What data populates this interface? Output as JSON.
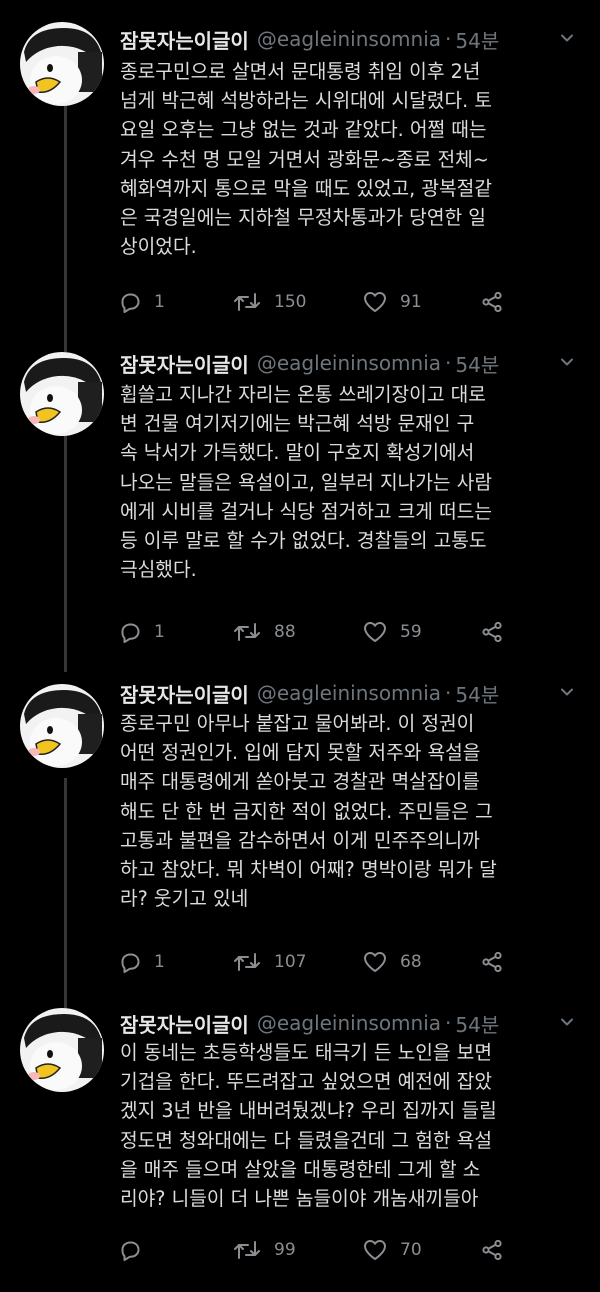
{
  "tweets": [
    {
      "display_name": "잠못자는이글이",
      "handle": "@eagleininsomnia",
      "separator": "·",
      "time": "54분",
      "lines": [
        "종로구민으로 살면서 문대통령 취임 이후 2년",
        "넘게 박근혜 석방하라는 시위대에 시달렸다. 토",
        "요일 오후는 그냥 없는 것과 같았다. 어쩔 때는",
        "겨우 수천 명 모일 거면서 광화문~종로 전체~",
        "혜화역까지 통으로 막을 때도 있었고, 광복절같",
        "은 국경일에는 지하철 무정차통과가 당연한 일",
        "상이었다."
      ],
      "replies": "1",
      "retweets": "150",
      "likes": "91"
    },
    {
      "display_name": "잠못자는이글이",
      "handle": "@eagleininsomnia",
      "separator": "·",
      "time": "54분",
      "lines": [
        "휩쓸고 지나간 자리는 온통 쓰레기장이고 대로",
        "변 건물 여기저기에는  박근혜 석방 문재인 구",
        "속 낙서가 가득했다. 말이 구호지 확성기에서",
        "나오는 말들은 욕설이고, 일부러 지나가는 사람",
        "에게 시비를 걸거나 식당 점거하고 크게 떠드는",
        "등 이루 말로 할 수가 없었다. 경찰들의 고통도",
        "극심했다."
      ],
      "replies": "1",
      "retweets": "88",
      "likes": "59"
    },
    {
      "display_name": "잠못자는이글이",
      "handle": "@eagleininsomnia",
      "separator": "·",
      "time": "54분",
      "lines": [
        "종로구민 아무나 붙잡고 물어봐라. 이 정권이",
        "어떤 정권인가. 입에 담지 못할 저주와 욕설을",
        "매주 대통령에게 쏟아붓고 경찰관 멱살잡이를",
        "해도 단 한 번 금지한 적이 없었다. 주민들은 그",
        "고통과 불편을 감수하면서 이게 민주주의니까",
        "하고 참았다. 뭐 차벽이 어째? 명박이랑 뭐가 달",
        "라? 웃기고 있네"
      ],
      "replies": "1",
      "retweets": "107",
      "likes": "68"
    },
    {
      "display_name": "잠못자는이글이",
      "handle": "@eagleininsomnia",
      "separator": "·",
      "time": "54분",
      "lines": [
        "이 동네는 초등학생들도 태극기 든 노인을 보면",
        "기겁을 한다. 뚜드려잡고 싶었으면 예전에 잡았",
        "겠지 3년 반을 내버려뒀겠냐? 우리 집까지 들릴",
        "정도면 청와대에는 다 들렸을건데 그 험한 욕설",
        "을 매주 들으며 살았을 대통령한테 그게 할 소",
        "리야? 니들이 더 나쁜 놈들이야 개놈새끼들아"
      ],
      "replies": "",
      "retweets": "99",
      "likes": "70"
    }
  ],
  "icons": {
    "avatar": "cartoon-bird-avatar",
    "menu": "chevron-down-icon",
    "reply": "reply-icon",
    "retweet": "retweet-icon",
    "like": "heart-icon",
    "share": "share-icon"
  },
  "colors": {
    "background": "#000000",
    "text": "#dcdcdc",
    "secondary": "#6e767d",
    "action": "#8b8f93",
    "thread_line": "#333639"
  }
}
